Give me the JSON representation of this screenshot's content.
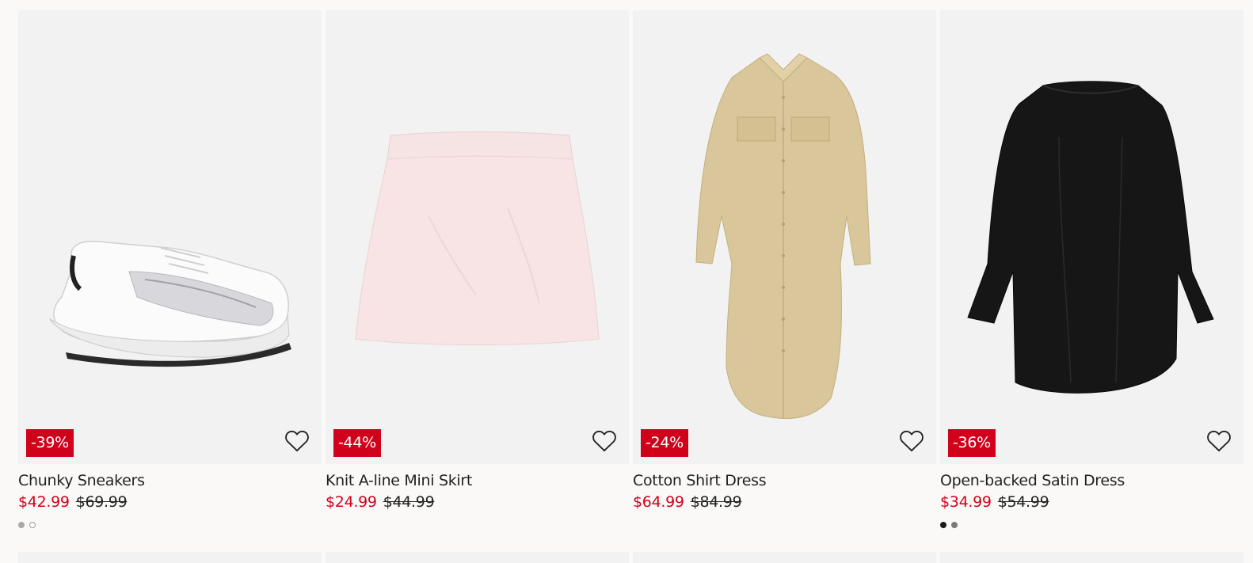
{
  "products": [
    {
      "name": "Chunky Sneakers",
      "discount": "-39%",
      "price": "$42.99",
      "original_price": "$69.99",
      "image": "white-silver-sneaker",
      "swatches": [
        "#a8a8a8",
        "#ffffff"
      ]
    },
    {
      "name": "Knit A-line Mini Skirt",
      "discount": "-44%",
      "price": "$24.99",
      "original_price": "$44.99",
      "image": "light-pink-mini-skirt",
      "swatches": []
    },
    {
      "name": "Cotton Shirt Dress",
      "discount": "-24%",
      "price": "$64.99",
      "original_price": "$84.99",
      "image": "beige-shirt-dress",
      "swatches": []
    },
    {
      "name": "Open-backed Satin Dress",
      "discount": "-36%",
      "price": "$34.99",
      "original_price": "$54.99",
      "image": "black-satin-dress",
      "swatches": [
        "#1a1a1a",
        "#7a7a7a"
      ]
    }
  ],
  "icons": {
    "favorite": "heart-outline-icon"
  },
  "colors": {
    "sale": "#d0021b",
    "image_bg": "#f2f2f2",
    "page_bg": "#faf9f8"
  }
}
